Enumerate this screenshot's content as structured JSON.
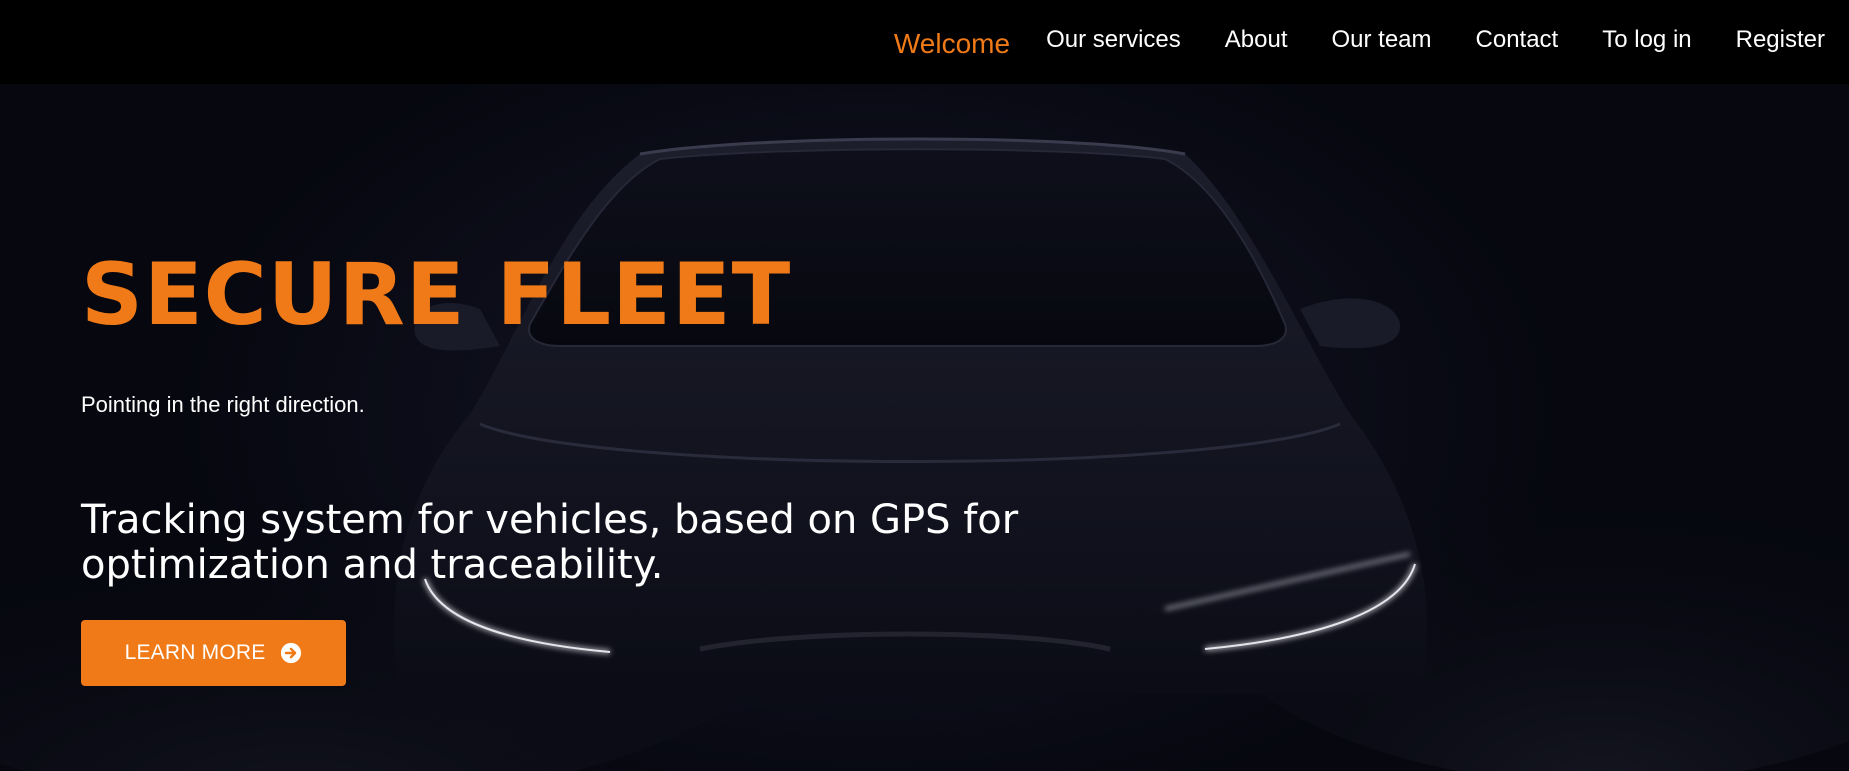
{
  "nav": {
    "items": [
      {
        "label": "Welcome",
        "active": true
      },
      {
        "label": "Our services",
        "active": false
      },
      {
        "label": "About",
        "active": false
      },
      {
        "label": "Our team",
        "active": false
      },
      {
        "label": "Contact",
        "active": false
      },
      {
        "label": "To log in",
        "active": false
      },
      {
        "label": "Register",
        "active": false
      }
    ]
  },
  "hero": {
    "title": "SECURE FLEET",
    "tagline": "Pointing in the right direction.",
    "description": "Tracking system for vehicles, based on GPS for optimization and traceability.",
    "cta": {
      "label": "LEARN MORE",
      "icon": "arrow-right-circle-icon"
    },
    "background_image": "car-front-silhouette"
  },
  "colors": {
    "accent": "#f07a17",
    "topbar": "#000000",
    "hero_bg": "#05060f",
    "text": "#ffffff"
  }
}
